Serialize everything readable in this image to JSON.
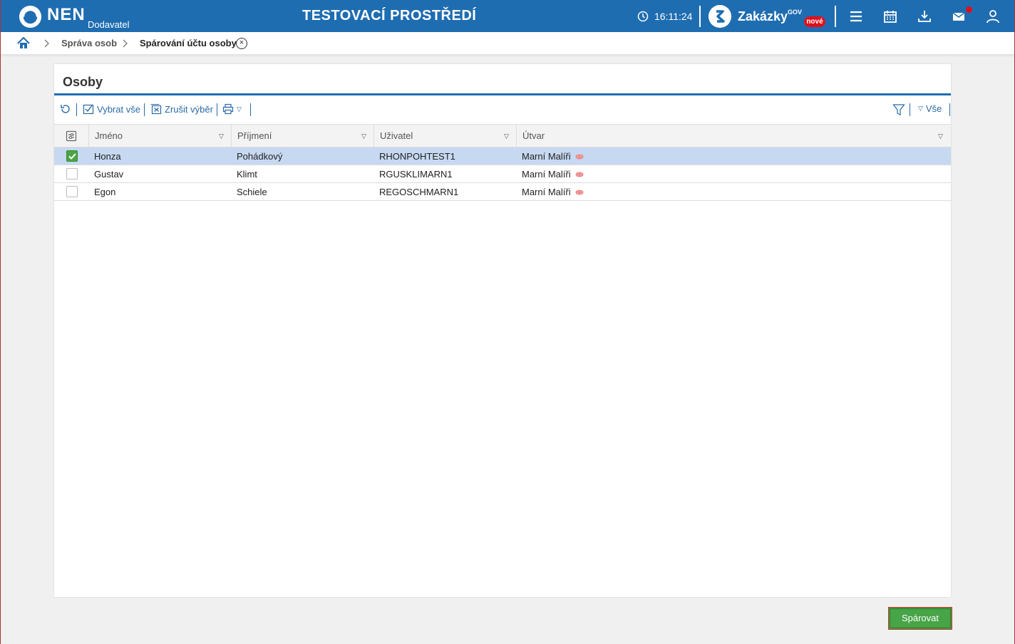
{
  "header": {
    "brand": "NEN",
    "brand_sub": "Dodavatel",
    "env_title": "TESTOVACÍ PROSTŘEDÍ",
    "time": "16:11:24",
    "zakazky": "Zakázky",
    "zakazky_gov": "GOV",
    "zakazky_badge": "nové",
    "icons": [
      "clock-icon",
      "menu-icon",
      "calendar-icon",
      "download-icon",
      "mail-icon",
      "user-icon"
    ]
  },
  "breadcrumb": {
    "items": [
      "Správa osob",
      "Spárování účtu osoby"
    ]
  },
  "panel": {
    "title": "Osoby"
  },
  "toolbar": {
    "select_all": "Vybrat vše",
    "deselect": "Zrušit výběr",
    "filter_all": "Vše"
  },
  "table": {
    "columns": [
      "Jméno",
      "Příjmení",
      "Uživatel",
      "Útvar"
    ],
    "rows": [
      {
        "checked": true,
        "jmeno": "Honza",
        "prijmeni": "Pohádkový",
        "uzivatel": "RHONPOHTEST1",
        "utvar": "Marní Malíři"
      },
      {
        "checked": false,
        "jmeno": "Gustav",
        "prijmeni": "Klimt",
        "uzivatel": "RGUSKLIMARN1",
        "utvar": "Marní Malíři"
      },
      {
        "checked": false,
        "jmeno": "Egon",
        "prijmeni": "Schiele",
        "uzivatel": "REGOSCHMARN1",
        "utvar": "Marní Malíři"
      }
    ]
  },
  "actions": {
    "pair_button": "Spárovat"
  },
  "colors": {
    "header_bg": "#1f6db1",
    "selected_row": "#c6d9f1",
    "primary_button": "#47a447",
    "badge_red": "#e0101a"
  }
}
